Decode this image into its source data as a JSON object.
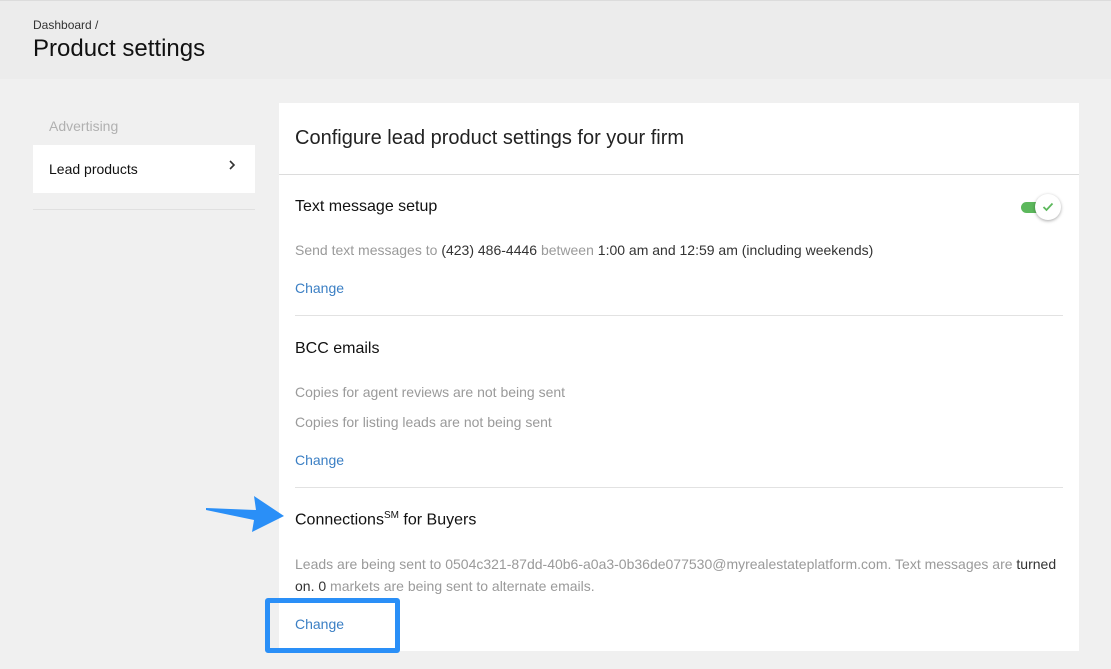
{
  "header": {
    "breadcrumb": "Dashboard /",
    "title": "Product settings"
  },
  "sidebar": {
    "heading": "Advertising",
    "items": [
      {
        "label": "Lead products",
        "icon": "chevron-right-icon"
      }
    ]
  },
  "card": {
    "title": "Configure lead product settings for your firm",
    "sections": {
      "text_message": {
        "title": "Text message setup",
        "toggle_on": true,
        "line_prefix": "Send text messages to",
        "phone": "(423) 486-4446",
        "between": "between",
        "time_range": "1:00 am and 12:59 am (including weekends)",
        "change_label": "Change"
      },
      "bcc": {
        "title": "BCC emails",
        "line1": "Copies for agent reviews are not being sent",
        "line2": "Copies for listing leads are not being sent",
        "change_label": "Change"
      },
      "connections": {
        "title": "Connections",
        "title_sup": "SM",
        "title_suffix": "for Buyers",
        "line1_prefix": "Leads are being sent to 0504c321-87dd-40b6-a0a3-0b36de077530@myrealestateplatform.com. Text messages are",
        "line1_status": "turned",
        "line2_status": "on.",
        "line2_count": "0",
        "line2_suffix": "markets are being sent to alternate emails.",
        "change_label": "Change"
      }
    }
  },
  "colors": {
    "link": "#3b7fc4",
    "toggle_on": "#5cb85c",
    "annotation": "#2a8ff7"
  }
}
